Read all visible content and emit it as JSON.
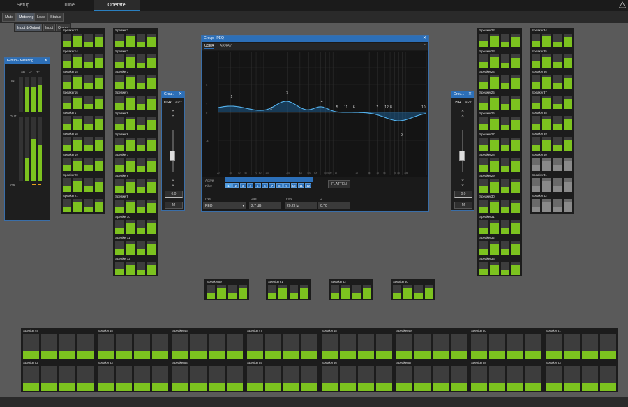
{
  "top_tabs": [
    {
      "label": "Setup",
      "active": false
    },
    {
      "label": "Tune",
      "active": false
    },
    {
      "label": "Operate",
      "active": true
    }
  ],
  "sub_tabs": [
    {
      "label": "Mute",
      "active": false
    },
    {
      "label": "Metering",
      "active": true
    },
    {
      "label": "Load",
      "active": false
    },
    {
      "label": "Status",
      "active": false
    }
  ],
  "dropdown": [
    {
      "label": "Input & Output",
      "active": true
    },
    {
      "label": "Input",
      "active": false
    },
    {
      "label": "Output",
      "active": false
    }
  ],
  "colors": {
    "accent": "#2c6fb8",
    "meter_green": "#7cc21f",
    "panel": "#1c1c1c"
  },
  "col_a": [
    {
      "name": "Speaker13",
      "levels": [
        0.45,
        0.8,
        0.4,
        0.75
      ]
    },
    {
      "name": "Speaker14",
      "levels": [
        0.45,
        0.8,
        0.4,
        0.75
      ]
    },
    {
      "name": "Speaker15",
      "levels": [
        0.45,
        0.8,
        0.4,
        0.75
      ]
    },
    {
      "name": "Speaker16",
      "levels": [
        0.45,
        0.8,
        0.4,
        0.75
      ]
    },
    {
      "name": "Speaker17",
      "levels": [
        0.45,
        0.8,
        0.4,
        0.75
      ]
    },
    {
      "name": "Speaker18",
      "levels": [
        0.45,
        0.8,
        0.4,
        0.75
      ]
    },
    {
      "name": "Speaker19",
      "levels": [
        0.45,
        0.8,
        0.4,
        0.75
      ]
    },
    {
      "name": "Speaker20",
      "levels": [
        0.45,
        0.8,
        0.4,
        0.75
      ]
    },
    {
      "name": "Speaker21",
      "levels": [
        0.45,
        0.8,
        0.4,
        0.75
      ]
    }
  ],
  "col_b": [
    {
      "name": "Speaker1",
      "levels": [
        0.45,
        0.8,
        0.4,
        0.75
      ]
    },
    {
      "name": "Speaker2",
      "levels": [
        0.45,
        0.8,
        0.4,
        0.75
      ]
    },
    {
      "name": "Speaker3",
      "levels": [
        0.45,
        0.8,
        0.4,
        0.75
      ]
    },
    {
      "name": "Speaker4",
      "levels": [
        0.45,
        0.8,
        0.4,
        0.75
      ]
    },
    {
      "name": "Speaker5",
      "levels": [
        0.45,
        0.8,
        0.4,
        0.75
      ]
    },
    {
      "name": "Speaker6",
      "levels": [
        0.45,
        0.8,
        0.4,
        0.75
      ]
    },
    {
      "name": "Speaker7",
      "levels": [
        0.45,
        0.8,
        0.4,
        0.75
      ]
    },
    {
      "name": "Speaker8",
      "levels": [
        0.45,
        0.8,
        0.4,
        0.75
      ]
    },
    {
      "name": "Speaker9",
      "levels": [
        0.45,
        0.8,
        0.4,
        0.75
      ]
    },
    {
      "name": "Speaker10",
      "levels": [
        0.45,
        0.8,
        0.4,
        0.75
      ]
    },
    {
      "name": "Speaker11",
      "levels": [
        0.45,
        0.8,
        0.4,
        0.75
      ]
    },
    {
      "name": "Speaker12",
      "levels": [
        0.45,
        0.8,
        0.4,
        0.75
      ]
    }
  ],
  "col_c": [
    {
      "name": "Speaker22",
      "levels": [
        0.45,
        0.8,
        0.4,
        0.75
      ]
    },
    {
      "name": "Speaker23",
      "levels": [
        0.45,
        0.8,
        0.4,
        0.75
      ]
    },
    {
      "name": "Speaker24",
      "levels": [
        0.45,
        0.8,
        0.4,
        0.75
      ]
    },
    {
      "name": "Speaker25",
      "levels": [
        0.45,
        0.8,
        0.4,
        0.75
      ]
    },
    {
      "name": "Speaker26",
      "levels": [
        0.45,
        0.8,
        0.4,
        0.75
      ]
    },
    {
      "name": "Speaker27",
      "levels": [
        0.45,
        0.8,
        0.4,
        0.75
      ]
    },
    {
      "name": "Speaker28",
      "levels": [
        0.45,
        0.8,
        0.4,
        0.75
      ]
    },
    {
      "name": "Speaker29",
      "levels": [
        0.45,
        0.8,
        0.4,
        0.75
      ]
    },
    {
      "name": "Speaker30",
      "levels": [
        0.45,
        0.8,
        0.4,
        0.75
      ]
    },
    {
      "name": "Speaker31",
      "levels": [
        0.45,
        0.8,
        0.4,
        0.75
      ]
    },
    {
      "name": "Speaker32",
      "levels": [
        0.45,
        0.8,
        0.4,
        0.75
      ]
    },
    {
      "name": "Speaker33",
      "levels": [
        0.45,
        0.8,
        0.4,
        0.75
      ]
    }
  ],
  "col_d": [
    {
      "name": "Speaker34",
      "levels": [
        0.45,
        0.8,
        0.4,
        0.75
      ],
      "gray": false
    },
    {
      "name": "Speaker35",
      "levels": [
        0.45,
        0.8,
        0.4,
        0.75
      ],
      "gray": false
    },
    {
      "name": "Speaker36",
      "levels": [
        0.45,
        0.8,
        0.4,
        0.75
      ],
      "gray": false
    },
    {
      "name": "Speaker37",
      "levels": [
        0.45,
        0.8,
        0.4,
        0.75
      ],
      "gray": false
    },
    {
      "name": "Speaker38",
      "levels": [
        0.45,
        0.8,
        0.4,
        0.75
      ],
      "gray": false
    },
    {
      "name": "Speaker39",
      "levels": [
        0.45,
        0.8,
        0.4,
        0.75
      ],
      "gray": false
    },
    {
      "name": "Speaker40",
      "levels": [
        0.45,
        0.8,
        0.4,
        0.75
      ],
      "gray": true
    },
    {
      "name": "Speaker41",
      "levels": [
        0.45,
        0.8,
        0.4,
        0.75
      ],
      "gray": true
    },
    {
      "name": "Speaker42",
      "levels": [
        0.45,
        0.8,
        0.4,
        0.75
      ],
      "gray": true
    }
  ],
  "middle_row": [
    {
      "name": "Speaker59",
      "levels": [
        0.45,
        0.8,
        0.4,
        0.75
      ]
    },
    {
      "name": "Speaker61",
      "levels": [
        0.45,
        0.8,
        0.4,
        0.75
      ]
    },
    {
      "name": "Speaker62",
      "levels": [
        0.45,
        0.8,
        0.4,
        0.75
      ]
    },
    {
      "name": "Speaker60",
      "levels": [
        0.45,
        0.8,
        0.4,
        0.75
      ]
    }
  ],
  "bottom_row1": [
    {
      "name": "Speaker44",
      "levels": [
        0.3,
        0.3,
        0.3,
        0.3
      ]
    },
    {
      "name": "Speaker45",
      "levels": [
        0.3,
        0.3,
        0.3,
        0.3
      ]
    },
    {
      "name": "Speaker46",
      "levels": [
        0.3,
        0.3,
        0.3,
        0.3
      ]
    },
    {
      "name": "Speaker47",
      "levels": [
        0.3,
        0.3,
        0.3,
        0.3
      ]
    },
    {
      "name": "Speaker48",
      "levels": [
        0.3,
        0.3,
        0.3,
        0.3
      ]
    },
    {
      "name": "Speaker49",
      "levels": [
        0.3,
        0.3,
        0.3,
        0.3
      ]
    },
    {
      "name": "Speaker50",
      "levels": [
        0.3,
        0.3,
        0.3,
        0.3
      ]
    },
    {
      "name": "Speaker51",
      "levels": [
        0.3,
        0.3,
        0.3,
        0.3
      ]
    }
  ],
  "bottom_row2": [
    {
      "name": "Speaker52",
      "levels": [
        0.3,
        0.3,
        0.3,
        0.3
      ]
    },
    {
      "name": "Speaker53",
      "levels": [
        0.3,
        0.3,
        0.3,
        0.3
      ]
    },
    {
      "name": "Speaker54",
      "levels": [
        0.3,
        0.3,
        0.3,
        0.3
      ]
    },
    {
      "name": "Speaker55",
      "levels": [
        0.3,
        0.3,
        0.3,
        0.3
      ]
    },
    {
      "name": "Speaker56",
      "levels": [
        0.3,
        0.3,
        0.3,
        0.3
      ]
    },
    {
      "name": "Speaker57",
      "levels": [
        0.3,
        0.3,
        0.3,
        0.3
      ]
    },
    {
      "name": "Speaker58",
      "levels": [
        0.3,
        0.3,
        0.3,
        0.3
      ]
    },
    {
      "name": "Speaker63",
      "levels": [
        0.3,
        0.3,
        0.3,
        0.3
      ]
    }
  ],
  "metering": {
    "title": "Group - Metering",
    "col_labels": [
      "SB",
      "LF",
      "HF"
    ],
    "row_labels": [
      "IN",
      "OUT",
      "GR"
    ],
    "in_levels": [
      0.0,
      0.72,
      0.72,
      0.78
    ],
    "out_levels": [
      0.0,
      0.35,
      0.65,
      0.55
    ]
  },
  "left_fader": {
    "title": "Grou...",
    "tabs": [
      "USR",
      "ARY"
    ],
    "value": "0.0",
    "mute": "M",
    "level": 0.35
  },
  "right_fader": {
    "title": "Grou...",
    "tabs": [
      "USR",
      "ARY"
    ],
    "value": "0.0",
    "mute": "M",
    "level": 0.35
  },
  "peq": {
    "title": "Group - PEQ",
    "tabs": [
      "USER",
      "ARRAY"
    ],
    "collapse": "^",
    "y_ticks": [
      "4",
      "1",
      "0",
      "-4"
    ],
    "freq_ticks": [
      "20",
      "30",
      "40",
      "50",
      "70",
      "80",
      "100",
      "200",
      "300",
      "400",
      "500",
      "700",
      "800",
      "1k",
      "2k",
      "3k",
      "4k",
      "5k",
      "7k",
      "8k",
      "10k"
    ],
    "band_markers": [
      "1",
      "2",
      "3",
      "4",
      "5",
      "11",
      "6",
      "7",
      "12",
      "8",
      "9",
      "10"
    ],
    "active_label": "Active",
    "filter_label": "Filter",
    "filters": [
      "1",
      "2",
      "3",
      "4",
      "5",
      "6",
      "7",
      "8",
      "9",
      "10",
      "11",
      "12"
    ],
    "flatten": "FLATTEN",
    "fields": [
      {
        "label": "Type",
        "value": "PEQ"
      },
      {
        "label": "Gain",
        "value": "2.7 dB"
      },
      {
        "label": "Freq",
        "value": "20.2 Hz"
      },
      {
        "label": "Q",
        "value": "0.70"
      }
    ]
  }
}
